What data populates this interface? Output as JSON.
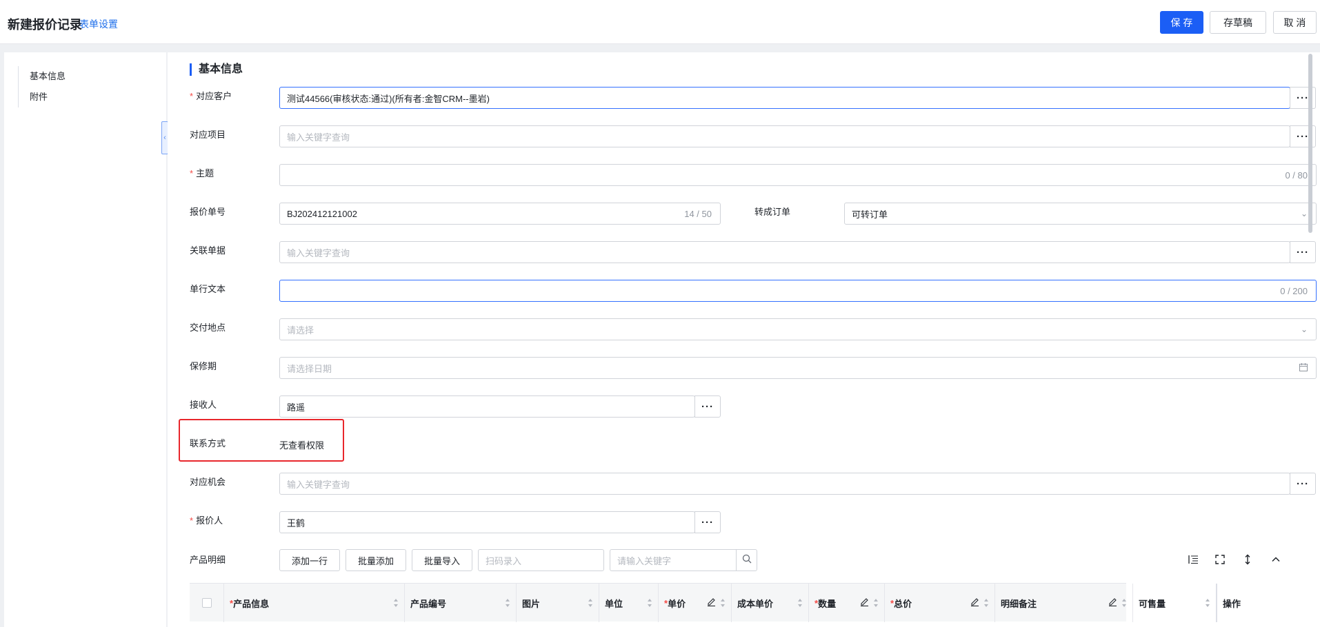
{
  "header": {
    "title": "新建报价记录",
    "form_settings": "表单设置",
    "save": "保 存",
    "draft": "存草稿",
    "cancel": "取 消"
  },
  "sidebar": {
    "items": [
      {
        "label": "基本信息"
      },
      {
        "label": "附件"
      }
    ],
    "collapse_icon": "chevron-left-icon"
  },
  "section": {
    "title": "基本信息"
  },
  "fields": {
    "customer": {
      "label": "对应客户",
      "required": true,
      "value": "测试44566(审核状态:通过)(所有者:金智CRM--墨岩)"
    },
    "project": {
      "label": "对应项目",
      "placeholder": "输入关键字查询"
    },
    "subject": {
      "label": "主题",
      "required": true,
      "counter": "0 / 80"
    },
    "quote_no": {
      "label": "报价单号",
      "value": "BJ202412121002",
      "counter": "14 / 50"
    },
    "convert_order": {
      "label": "转成订单",
      "value": "可转订单"
    },
    "related_doc": {
      "label": "关联单据",
      "placeholder": "输入关键字查询"
    },
    "single_text": {
      "label": "单行文本",
      "counter": "0 / 200"
    },
    "delivery_place": {
      "label": "交付地点",
      "placeholder": "请选择"
    },
    "warranty": {
      "label": "保修期",
      "placeholder": "请选择日期"
    },
    "receiver": {
      "label": "接收人",
      "value": "路遥"
    },
    "contact": {
      "label": "联系方式",
      "value": "无查看权限"
    },
    "opportunity": {
      "label": "对应机会",
      "placeholder": "输入关键字查询"
    },
    "quoter": {
      "label": "报价人",
      "required": true,
      "value": "王鹤"
    }
  },
  "product_detail": {
    "label": "产品明细",
    "add_row": "添加一行",
    "batch_add": "批量添加",
    "batch_import": "批量导入",
    "scan_placeholder": "扫码录入",
    "keyword_placeholder": "请输入关键字",
    "columns": [
      {
        "label": "产品信息",
        "required": true
      },
      {
        "label": "产品编号"
      },
      {
        "label": "图片"
      },
      {
        "label": "单位"
      },
      {
        "label": "单价",
        "required": true,
        "editable": true
      },
      {
        "label": "成本单价"
      },
      {
        "label": "数量",
        "required": true,
        "editable": true
      },
      {
        "label": "总价",
        "required": true,
        "editable": true
      },
      {
        "label": "明细备注",
        "editable": true
      },
      {
        "label": "可售量"
      },
      {
        "label": "操作"
      }
    ]
  },
  "colors": {
    "primary": "#1b5ef5",
    "required": "#f54a45",
    "highlight": "#e8262b"
  }
}
